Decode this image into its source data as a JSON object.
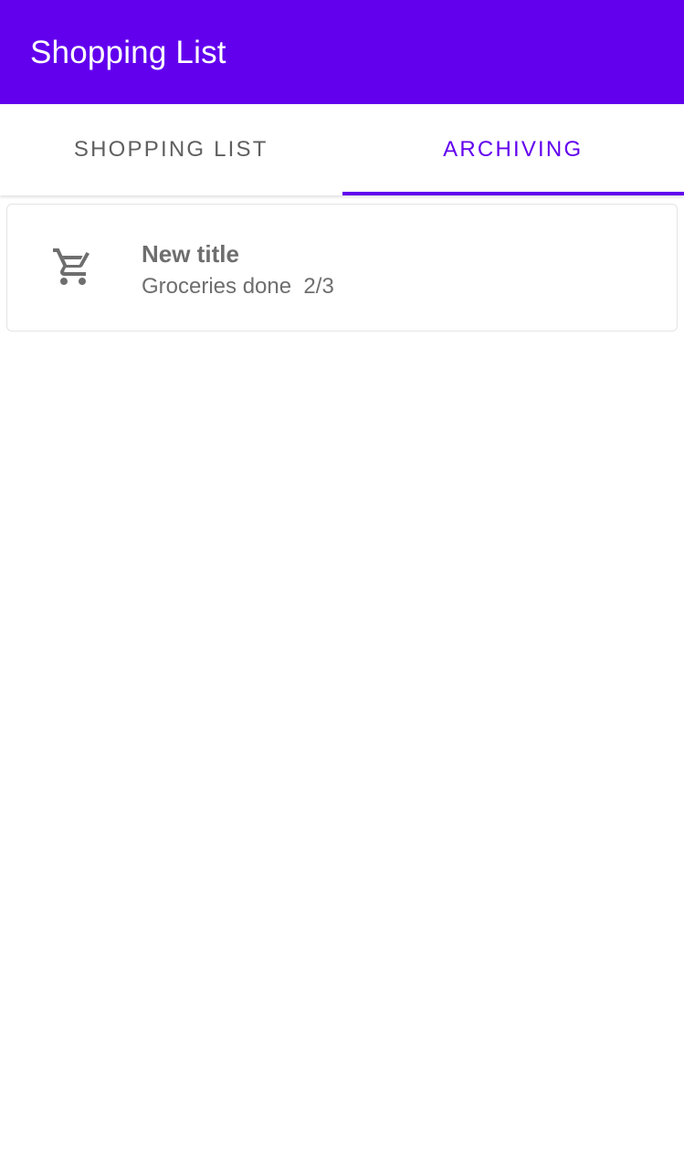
{
  "app": {
    "title": "Shopping List",
    "accent_color": "#6200ee"
  },
  "tabs": [
    {
      "label": "SHOPPING LIST",
      "selected": false
    },
    {
      "label": "ARCHIVING",
      "selected": true
    }
  ],
  "items": [
    {
      "icon": "cart-icon",
      "title": "New title",
      "subtitle": "Groceries done  2/3"
    }
  ]
}
